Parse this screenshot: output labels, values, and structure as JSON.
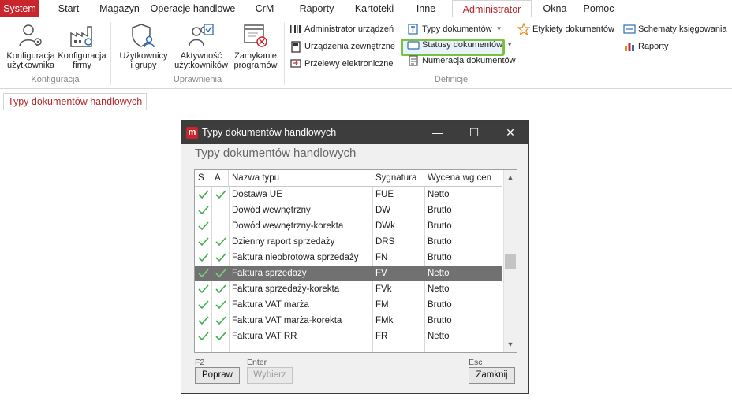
{
  "menu": [
    {
      "label": "System"
    },
    {
      "label": "Start"
    },
    {
      "label": "Magazyn"
    },
    {
      "label": "Operacje handlowe"
    },
    {
      "label": "CrM"
    },
    {
      "label": "Raporty"
    },
    {
      "label": "Kartoteki"
    },
    {
      "label": "Inne"
    },
    {
      "label": "Administrator"
    },
    {
      "label": "Okna"
    },
    {
      "label": "Pomoc"
    }
  ],
  "ribbon": {
    "konfiguracja": {
      "user_config": "Konfiguracja\nużytkownika",
      "firm_config": "Konfiguracja\nfirmy",
      "group_label": "Konfiguracja"
    },
    "uprawnienia": {
      "users_groups": "Użytkownicy\ni grupy",
      "user_activity": "Aktywność\nużytkowników",
      "close_programs": "Zamykanie\nprogramów",
      "group_label": "Uprawnienia"
    },
    "definicje": {
      "device_admin": "Administrator urządzeń",
      "external_devices": "Urządzenia zewnętrzne",
      "e_transfers": "Przelewy elektroniczne",
      "doc_types": "Typy dokumentów",
      "doc_statuses": "Statusy dokumentów",
      "doc_numbering": "Numeracja dokumentów",
      "doc_labels": "Etykiety dokumentów",
      "accounting_schemes": "Schematy księgowania",
      "reports": "Raporty",
      "group_label": "Definicje"
    }
  },
  "doc_tab": {
    "label": "Typy dokumentów handlowych"
  },
  "dialog": {
    "title": "Typy dokumentów handlowych",
    "heading": "Typy dokumentów handlowych",
    "columns": {
      "s": "S",
      "a": "A",
      "name": "Nazwa typu",
      "signature": "Sygnatura",
      "valuation": "Wycena wg cen"
    },
    "rows": [
      {
        "s": true,
        "a": true,
        "name": "Dostawa UE",
        "signature": "FUE",
        "valuation": "Netto",
        "selected": false
      },
      {
        "s": true,
        "a": false,
        "name": "Dowód wewnętrzny",
        "signature": "DW",
        "valuation": "Brutto",
        "selected": false
      },
      {
        "s": true,
        "a": false,
        "name": "Dowód wewnętrzny-korekta",
        "signature": "DWk",
        "valuation": "Brutto",
        "selected": false
      },
      {
        "s": true,
        "a": true,
        "name": "Dzienny raport sprzedaży",
        "signature": "DRS",
        "valuation": "Brutto",
        "selected": false
      },
      {
        "s": true,
        "a": true,
        "name": "Faktura nieobrotowa sprzedaży",
        "signature": "FN",
        "valuation": "Brutto",
        "selected": false
      },
      {
        "s": true,
        "a": true,
        "name": "Faktura sprzedaży",
        "signature": "FV",
        "valuation": "Netto",
        "selected": true
      },
      {
        "s": true,
        "a": true,
        "name": "Faktura sprzedaży-korekta",
        "signature": "FVk",
        "valuation": "Netto",
        "selected": false
      },
      {
        "s": true,
        "a": true,
        "name": "Faktura VAT marża",
        "signature": "FM",
        "valuation": "Brutto",
        "selected": false
      },
      {
        "s": true,
        "a": true,
        "name": "Faktura VAT marża-korekta",
        "signature": "FMk",
        "valuation": "Brutto",
        "selected": false
      },
      {
        "s": true,
        "a": true,
        "name": "Faktura VAT RR",
        "signature": "FR",
        "valuation": "Netto",
        "selected": false
      }
    ],
    "buttons": {
      "edit": {
        "key": "F2",
        "label": "Popraw"
      },
      "select": {
        "key": "Enter",
        "label": "Wybierz"
      },
      "close": {
        "key": "Esc",
        "label": "Zamknij"
      }
    }
  },
  "colors": {
    "accent": "#c8252c",
    "highlight": "#7ac142",
    "selected_row": "#717171",
    "check": "#4caf50"
  }
}
